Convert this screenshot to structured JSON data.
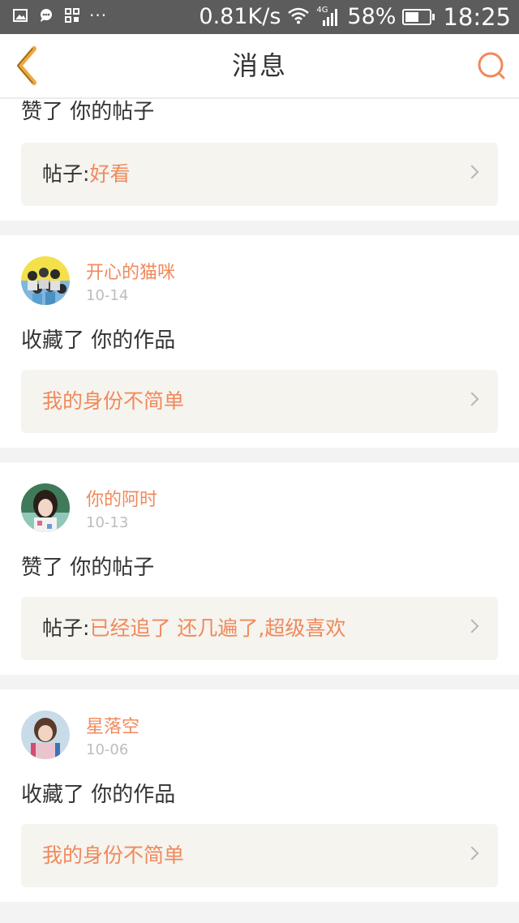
{
  "status_bar": {
    "network_speed": "0.81K/s",
    "network_type": "4G",
    "battery": "58%",
    "battery_level": 0.58,
    "time": "18:25"
  },
  "header": {
    "title": "消息"
  },
  "colors": {
    "accent": "#f0895c",
    "back_arrow": "#f2a63a",
    "text": "#333333",
    "date": "#bdbdbd",
    "preview_bg": "#f5f4ef"
  },
  "messages": [
    {
      "action": "赞了 你的帖子",
      "preview_prefix": "帖子:",
      "preview_text": "好看"
    },
    {
      "username": "开心的猫咪",
      "date": "10-14",
      "action": "收藏了 你的作品",
      "preview_prefix": "",
      "preview_text": "我的身份不简单"
    },
    {
      "username": "你的阿时",
      "date": "10-13",
      "action": "赞了 你的帖子",
      "preview_prefix": "帖子:",
      "preview_text": "已经追了 还几遍了,超级喜欢"
    },
    {
      "username": "星落空",
      "date": "10-06",
      "action": "收藏了 你的作品",
      "preview_prefix": "",
      "preview_text": "我的身份不简单"
    }
  ]
}
